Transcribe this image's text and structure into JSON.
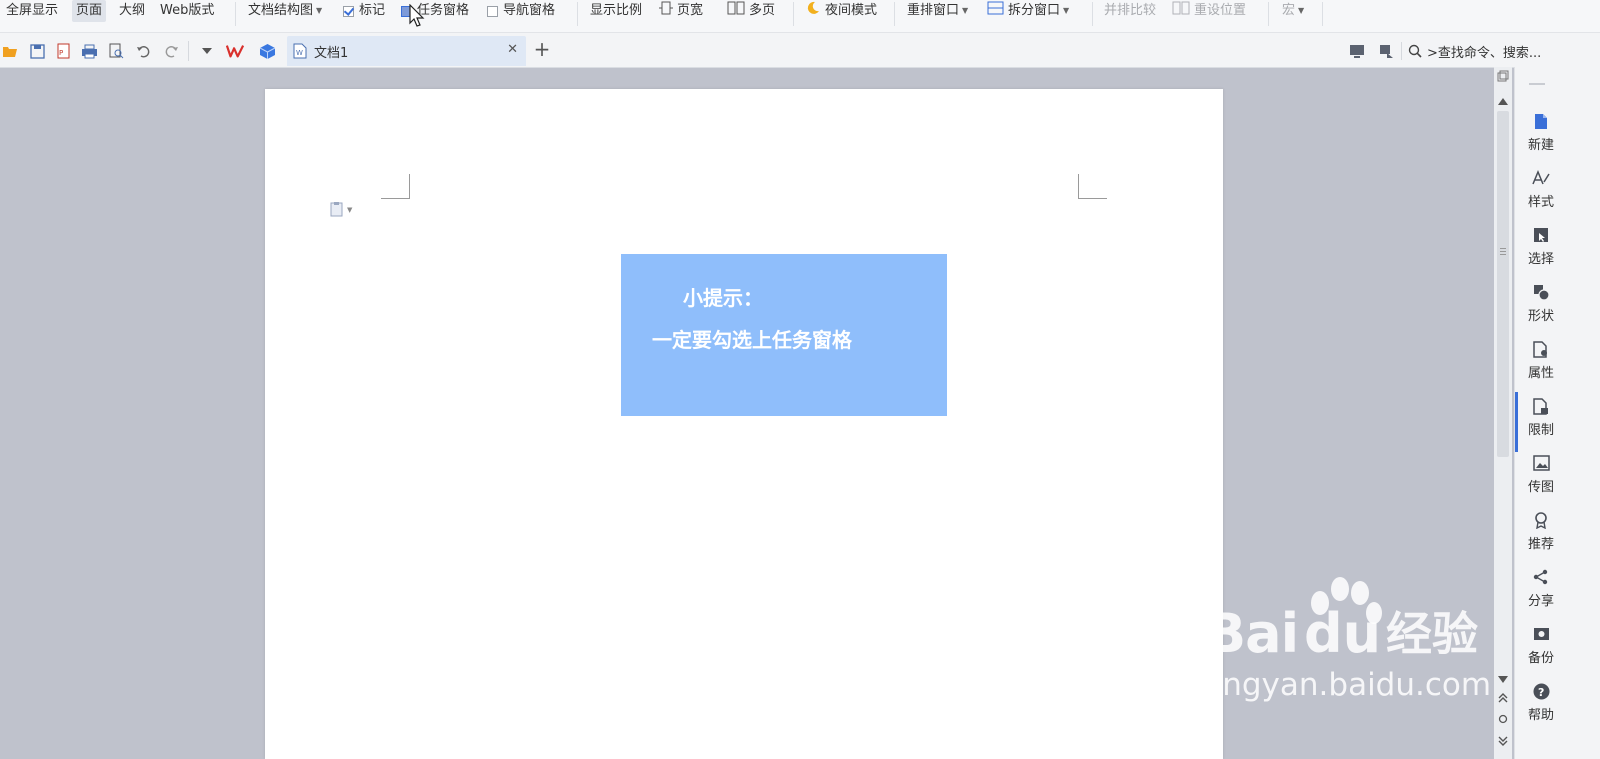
{
  "ribbon": {
    "fullscreen": "全屏显示",
    "page_view": "页面",
    "outline": "大纲",
    "web_layout": "Web版式",
    "doc_map": "文档结构图",
    "markup": "标记",
    "task_pane": "任务窗格",
    "nav_pane": "导航窗格",
    "zoom": "显示比例",
    "page_width": "页宽",
    "multi_page": "多页",
    "night_mode": "夜间模式",
    "arrange": "重排窗口",
    "split": "拆分窗口",
    "side_by_side": "并排比较",
    "reset_pos": "重设位置",
    "macro": "宏"
  },
  "tabbar": {
    "doc_tab": "文档1",
    "search_placeholder": ">查找命令、搜索..."
  },
  "document": {
    "tip_title": "小提示：",
    "tip_body": "一定要勾选上任务窗格"
  },
  "right_panel": {
    "items": [
      {
        "label": "新建",
        "icon": "new-doc-icon"
      },
      {
        "label": "样式",
        "icon": "style-icon"
      },
      {
        "label": "选择",
        "icon": "select-icon"
      },
      {
        "label": "形状",
        "icon": "shape-icon"
      },
      {
        "label": "属性",
        "icon": "property-icon"
      },
      {
        "label": "限制",
        "icon": "restrict-icon"
      },
      {
        "label": "传图",
        "icon": "upload-image-icon"
      },
      {
        "label": "推荐",
        "icon": "recommend-icon"
      },
      {
        "label": "分享",
        "icon": "share-icon"
      },
      {
        "label": "备份",
        "icon": "backup-icon"
      },
      {
        "label": "帮助",
        "icon": "help-icon"
      }
    ]
  },
  "watermark": {
    "brand": "Bai",
    "brand_tail": "du",
    "product": "经验",
    "url": "jingyan.baidu.com"
  },
  "colors": {
    "accent": "#3a6fd8",
    "tip_box": "#8fbefb",
    "workspace": "#bfc2cc"
  }
}
